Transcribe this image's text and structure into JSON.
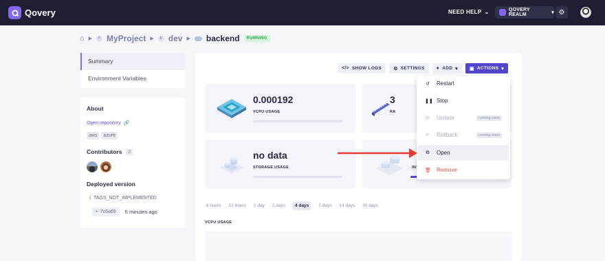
{
  "topbar": {
    "brand": "Qovery",
    "help": "NEED HELP",
    "realm": "QOVERY REALM"
  },
  "breadcrumb": {
    "project": "MyProject",
    "project_badge": "P",
    "environment": "dev",
    "environment_badge": "E",
    "application": "backend",
    "status": "RUNNING"
  },
  "nav": {
    "items": [
      {
        "label": "Summary",
        "active": true
      },
      {
        "label": "Environment Variables",
        "active": false
      }
    ]
  },
  "about": {
    "title": "About",
    "repo_link": "Open repository",
    "tags": [
      "aws",
      "azure"
    ],
    "contributors_title": "Contributors",
    "contributors_count": "2",
    "deployed_title": "Deployed version",
    "tag_name": "TAGS_NOT_IMPLEMENTED",
    "commit": "7c6a69",
    "deployed_ago": "5 minutes ago"
  },
  "toolbar": {
    "logs": "SHOW LOGS",
    "settings": "SETTINGS",
    "add": "ADD",
    "actions": "ACTIONS"
  },
  "metrics": {
    "vcpu_value": "0.000192",
    "vcpu_label": "VCPU USAGE",
    "ram_value": "3",
    "ram_label": "RA",
    "storage_value": "no data",
    "storage_label": "STORAGE USAGE",
    "instances_label": "INS"
  },
  "time_ranges": [
    "6 hours",
    "12 hours",
    "1 day",
    "2 days",
    "4 days",
    "7 days",
    "14 days",
    "30 days"
  ],
  "selected_range": "4 days",
  "chart_title": "VCPU USAGE",
  "actions_menu": {
    "restart": "Restart",
    "stop": "Stop",
    "update": "Update",
    "rollback": "Rollback",
    "open": "Open",
    "remove": "Remove",
    "coming_soon": "coming soon"
  },
  "colors": {
    "accent": "#5145cd",
    "brand": "#8667ef",
    "danger": "#e2513c",
    "running": "#2bab49",
    "annotation_arrow": "#e53b2c"
  }
}
